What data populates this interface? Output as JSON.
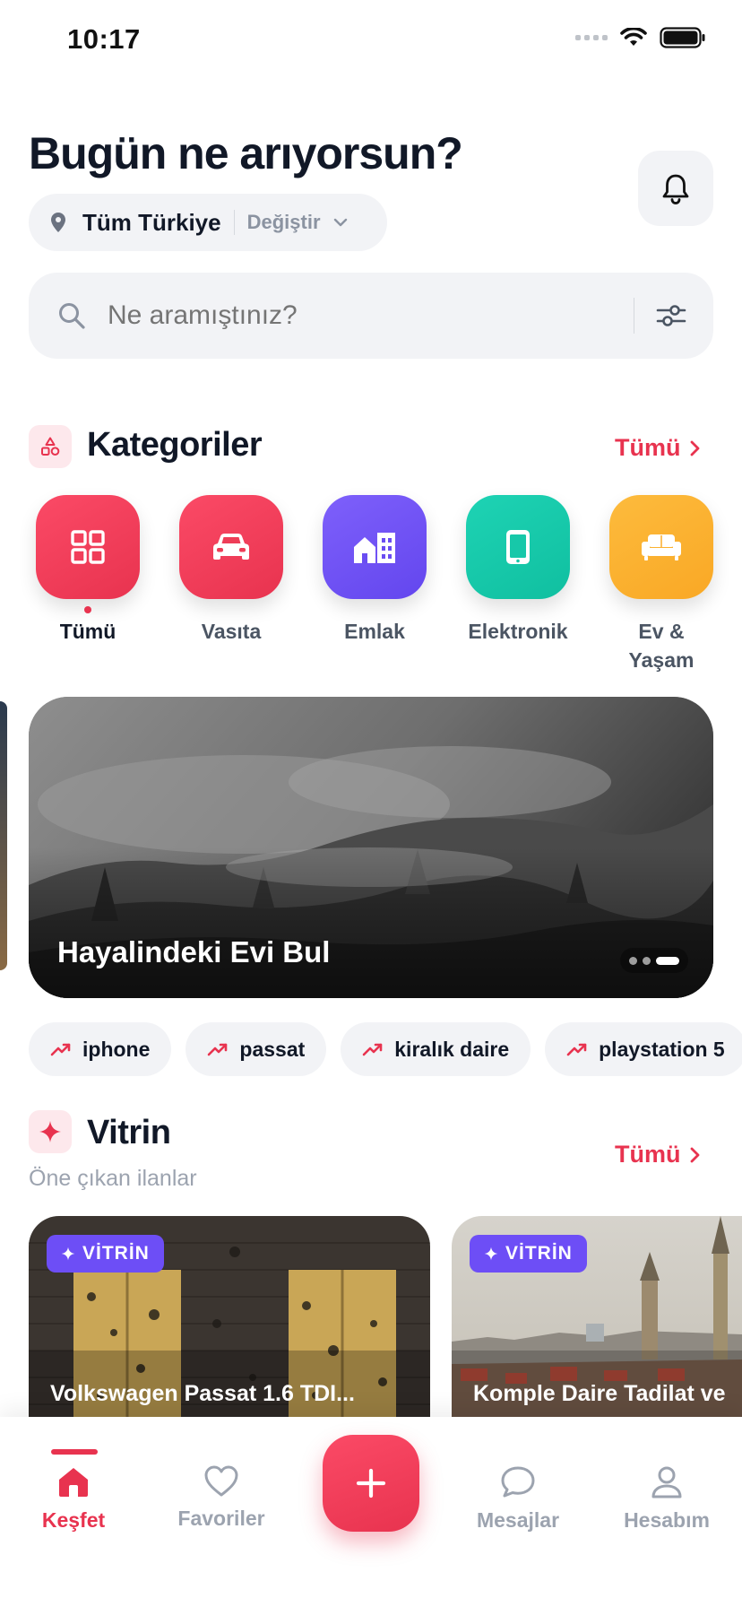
{
  "status_bar": {
    "time": "10:17"
  },
  "header": {
    "title": "Bugün ne arıyorsun?",
    "location": "Tüm Türkiye",
    "location_change": "Değiştir"
  },
  "search": {
    "placeholder": "Ne aramıştınız?"
  },
  "categories": {
    "title": "Kategoriler",
    "see_all": "Tümü",
    "items": [
      {
        "label": "Tümü",
        "icon": "grid-icon",
        "color": "#f0374f",
        "active": true
      },
      {
        "label": "Vasıta",
        "icon": "car-icon",
        "color": "#f0374f"
      },
      {
        "label": "Emlak",
        "icon": "building-icon",
        "color": "#6d4ef6"
      },
      {
        "label": "Elektronik",
        "icon": "phone-icon",
        "color": "#14c8a8"
      },
      {
        "label": "Ev & Yaşam",
        "icon": "sofa-icon",
        "color": "#fbae2e"
      }
    ]
  },
  "banner": {
    "title": "Hayalindeki Evi Bul",
    "pages": 3,
    "active_page": 3
  },
  "trends": [
    "iphone",
    "passat",
    "kiralık daire",
    "playstation 5"
  ],
  "vitrin": {
    "title": "Vitrin",
    "subtitle": "Öne çıkan ilanlar",
    "see_all": "Tümü",
    "badge": "VİTRİN",
    "cards": [
      {
        "title": "Volkswagen Passat 1.6 TDI..."
      },
      {
        "title": "Komple Daire Tadilat ve"
      }
    ]
  },
  "nav": {
    "items": [
      "Keşfet",
      "Favoriler",
      "Mesajlar",
      "Hesabım"
    ],
    "active": "Keşfet"
  },
  "colors": {
    "accent": "#e8334f",
    "purple": "#6d4ef6",
    "teal": "#14c8a8",
    "amber": "#fbae2e"
  }
}
